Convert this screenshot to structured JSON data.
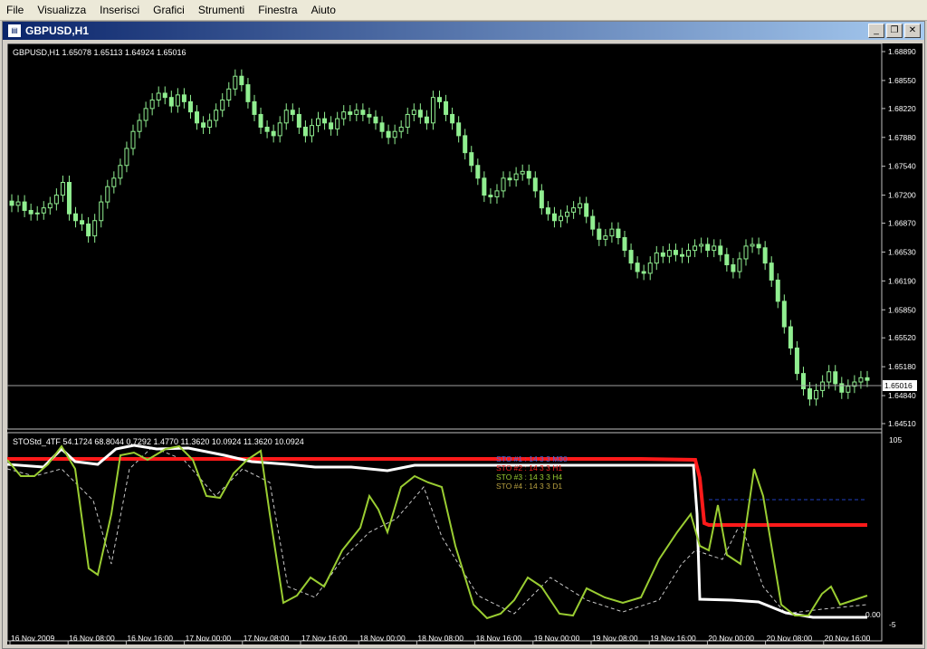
{
  "menu": [
    "File",
    "Visualizza",
    "Inserisci",
    "Grafici",
    "Strumenti",
    "Finestra",
    "Aiuto"
  ],
  "window": {
    "title": "GBPUSD,H1",
    "minimize_glyph": "_",
    "restore_glyph": "❐",
    "close_glyph": "✕"
  },
  "main_chart": {
    "header": "GBPUSD,H1  1.65078 1.65113 1.64924 1.65016",
    "current_price": "1.65016",
    "price_levels": [
      "1.68890",
      "1.68550",
      "1.68220",
      "1.67880",
      "1.67540",
      "1.67200",
      "1.66870",
      "1.66530",
      "1.66190",
      "1.65850",
      "1.65520",
      "1.65180",
      "1.64840",
      "1.64510"
    ]
  },
  "indicator": {
    "header": "STOStd_4TF 54.1724 68.8044 0.7292 1.4770 11.3620 10.0924 11.3620 10.0924",
    "scale_top": "105",
    "scale_zero": "0.00",
    "scale_bottom": "-5",
    "legend": [
      {
        "label": "STO #1 : 14 3 3  M30",
        "color": "#4169e1"
      },
      {
        "label": "STO #2 : 14 3 3  H1",
        "color": "#ff2020"
      },
      {
        "label": "STO #3 : 14 3 3  H4",
        "color": "#9acd32"
      },
      {
        "label": "STO #4 : 14 3 3  D1",
        "color": "#b8a040"
      }
    ]
  },
  "time_axis": [
    "16 Nov 2009",
    "16 Nov 08:00",
    "16 Nov 16:00",
    "17 Nov 00:00",
    "17 Nov 08:00",
    "17 Nov 16:00",
    "18 Nov 00:00",
    "18 Nov 08:00",
    "18 Nov 16:00",
    "19 Nov 00:00",
    "19 Nov 08:00",
    "19 Nov 16:00",
    "20 Nov 00:00",
    "20 Nov 08:00",
    "20 Nov 16:00"
  ],
  "colors": {
    "background": "#000000",
    "candle": "#90ee90",
    "grid_text": "#ffffff",
    "sto_h1": "#ff1a1a",
    "sto_h4": "#9acd32",
    "sto_main": "#ffffff",
    "sto_d1_dashed": "#2040c0"
  },
  "chart_data": {
    "type": "candlestick",
    "close_series": [
      1.6708,
      1.6712,
      1.6702,
      1.6698,
      1.6699,
      1.6705,
      1.671,
      1.672,
      1.6735,
      1.6698,
      1.669,
      1.6686,
      1.6672,
      1.669,
      1.6712,
      1.673,
      1.674,
      1.6755,
      1.6775,
      1.6795,
      1.6808,
      1.6822,
      1.6832,
      1.684,
      1.6835,
      1.6825,
      1.6838,
      1.683,
      1.6818,
      1.6805,
      1.68,
      1.6808,
      1.682,
      1.6832,
      1.6845,
      1.686,
      1.685,
      1.683,
      1.6815,
      1.68,
      1.6795,
      1.679,
      1.6805,
      1.682,
      1.6815,
      1.68,
      1.679,
      1.6802,
      1.681,
      1.6805,
      1.6798,
      1.681,
      1.6818,
      1.6815,
      1.682,
      1.6815,
      1.6812,
      1.6805,
      1.6795,
      1.6788,
      1.6795,
      1.68,
      1.6815,
      1.682,
      1.6812,
      1.6805,
      1.6835,
      1.683,
      1.6815,
      1.6805,
      1.679,
      1.677,
      1.6755,
      1.674,
      1.672,
      1.6718,
      1.6725,
      1.674,
      1.6738,
      1.6745,
      1.6748,
      1.674,
      1.6725,
      1.6705,
      1.6698,
      1.669,
      1.6695,
      1.67,
      1.6705,
      1.671,
      1.6695,
      1.668,
      1.6668,
      1.6672,
      1.668,
      1.667,
      1.6655,
      1.664,
      1.663,
      1.6628,
      1.664,
      1.6652,
      1.6648,
      1.6655,
      1.665,
      1.6648,
      1.6655,
      1.666,
      1.6662,
      1.6655,
      1.666,
      1.665,
      1.6638,
      1.663,
      1.6645,
      1.666,
      1.6662,
      1.6658,
      1.664,
      1.662,
      1.6595,
      1.6565,
      1.654,
      1.651,
      1.6492,
      1.648,
      1.649,
      1.65,
      1.6512,
      1.6498,
      1.6488,
      1.6495,
      1.65,
      1.6505,
      1.6502
    ]
  }
}
